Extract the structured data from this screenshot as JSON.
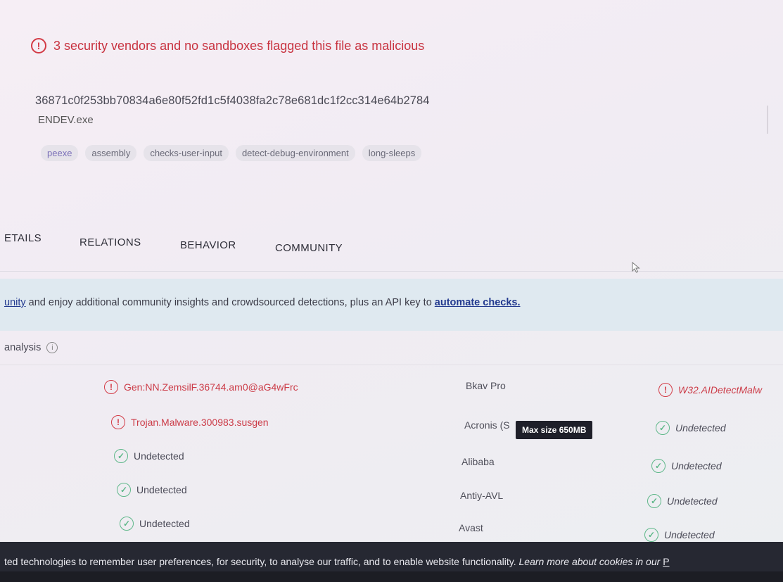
{
  "alert": {
    "icon": "alert-circle-icon",
    "text": "3 security vendors and no sandboxes flagged this file as malicious"
  },
  "file": {
    "hash": "36871c0f253bb70834a6e80f52fd1c5f4038fa2c78e681dc1f2cc314e64b2784",
    "name": "ENDEV.exe",
    "tags": [
      "peexe",
      "assembly",
      "checks-user-input",
      "detect-debug-environment",
      "long-sleeps"
    ]
  },
  "tabs": {
    "details": "ETAILS",
    "relations": "RELATIONS",
    "behavior": "BEHAVIOR",
    "community": "COMMUNITY"
  },
  "banner": {
    "link1": "unity",
    "text": " and enjoy additional community insights and crowdsourced detections, plus an API key to ",
    "link2": "automate checks."
  },
  "analysis": {
    "label": "analysis"
  },
  "rows": [
    {
      "left": "Gen:NN.ZemsilF.36744.am0@aG4wFrc",
      "left_status": "malicious",
      "vendor": "Bkav Pro",
      "right": "W32.AIDetectMalw",
      "right_status": "malicious"
    },
    {
      "left": "Trojan.Malware.300983.susgen",
      "left_status": "malicious",
      "vendor": "Acronis (S",
      "right": "Undetected",
      "right_status": "undetected"
    },
    {
      "left": "Undetected",
      "left_status": "undetected",
      "vendor": "Alibaba",
      "right": "Undetected",
      "right_status": "undetected"
    },
    {
      "left": "Undetected",
      "left_status": "undetected",
      "vendor": "Antiy-AVL",
      "right": "Undetected",
      "right_status": "undetected"
    },
    {
      "left": "Undetected",
      "left_status": "undetected",
      "vendor": "Avast",
      "right": "Undetected",
      "right_status": "undetected"
    }
  ],
  "tooltip": "Max size 650MB",
  "cookie": {
    "text": "ted technologies to remember user preferences, for security, to analyse our traffic, and to enable website functionality. ",
    "italic": "Learn more about cookies in our ",
    "link": "P"
  },
  "colors": {
    "danger": "#d33b46",
    "ok": "#5fb88a",
    "banner_bg": "#dfe9f0",
    "link": "#233a8f",
    "cookie_bg": "#262832"
  }
}
